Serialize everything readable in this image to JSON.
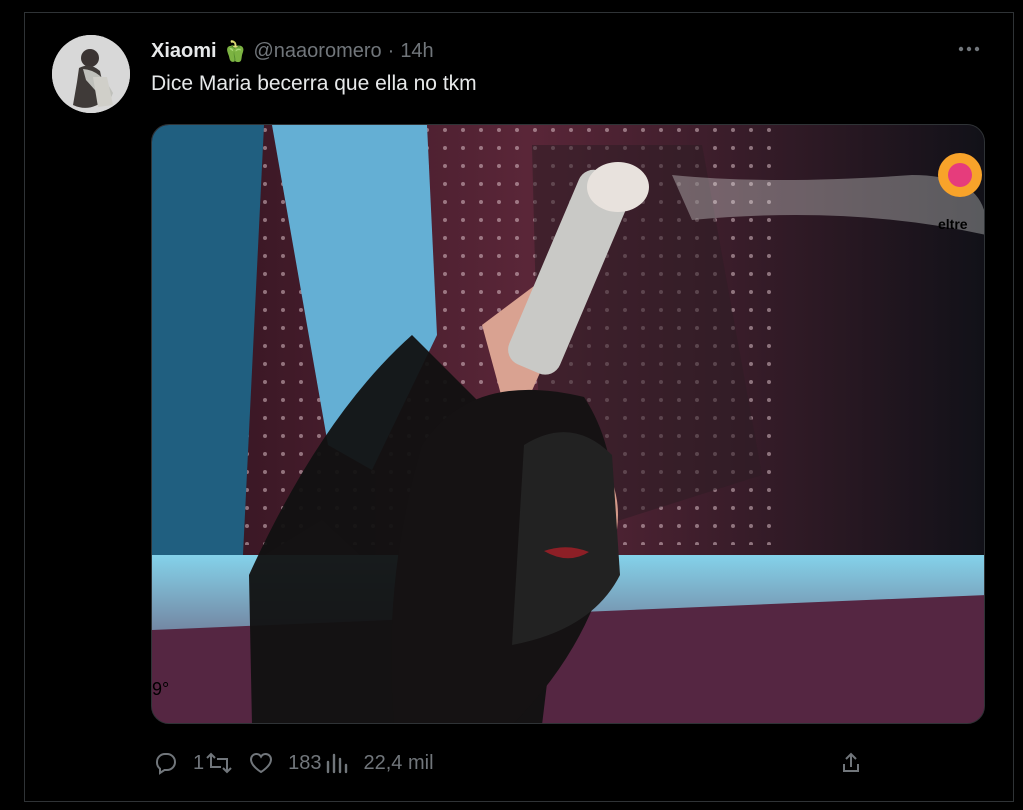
{
  "post": {
    "display_name": "Xiaomi",
    "emoji": "🫑",
    "handle": "@naaoromero",
    "separator": "·",
    "time": "14h",
    "text": "Dice Maria becerra que ella no tkm",
    "media": {
      "logo_text": "eltre",
      "corner_text": "9°"
    }
  },
  "actions": {
    "reply_count": "1",
    "repost_count": "",
    "like_count": "183",
    "view_count": "22,4 mil"
  },
  "icons": {
    "more": "ellipsis-icon",
    "reply": "reply-icon",
    "repost": "repost-icon",
    "like": "heart-icon",
    "views": "views-icon",
    "share": "share-icon"
  }
}
